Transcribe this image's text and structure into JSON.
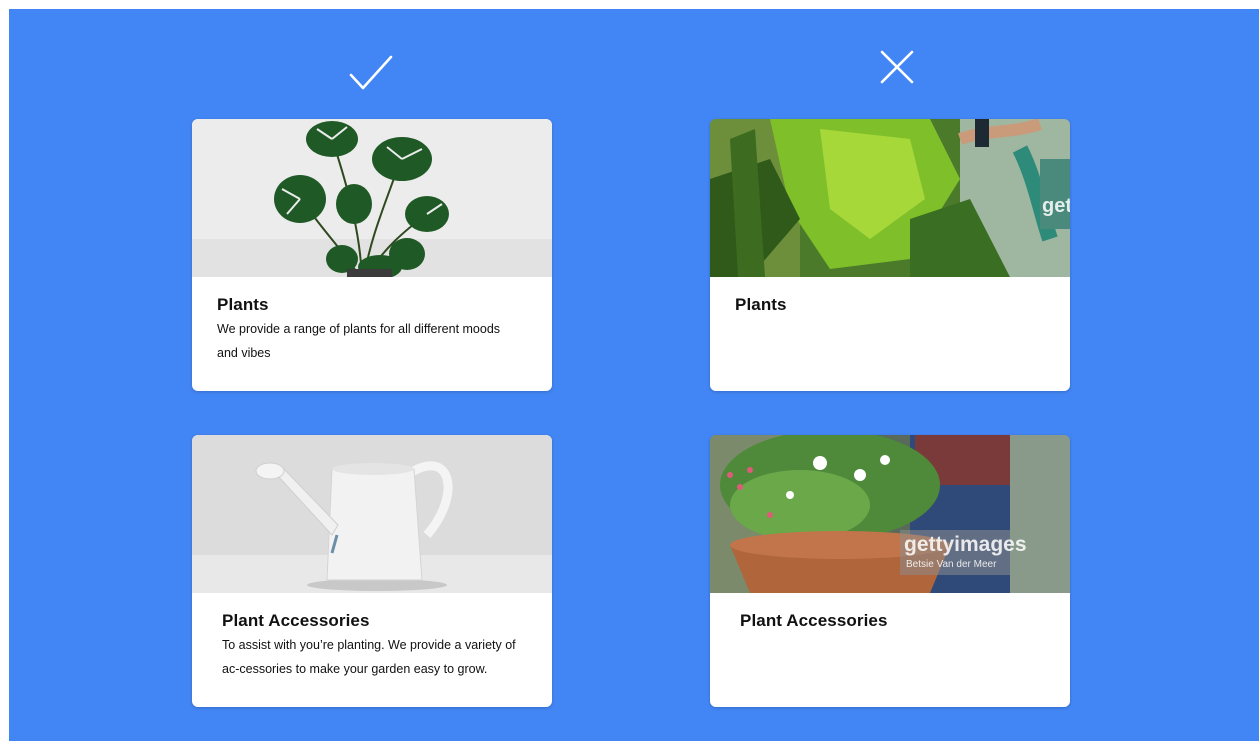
{
  "indicators": {
    "good": "check-icon",
    "bad": "close-icon"
  },
  "colors": {
    "background": "#4285f4",
    "card": "#ffffff",
    "text": "#111111"
  },
  "good_examples": [
    {
      "title": "Plants",
      "description": "We provide a range of plants for all different moods and vibes",
      "image": "monstera-plant-photo"
    },
    {
      "title": "Plant Accessories",
      "description": "To assist with you’re planting. We provide a variety of ac-cessories to make your garden easy to grow.",
      "image": "watering-can-photo"
    }
  ],
  "bad_examples": [
    {
      "title": "Plants",
      "image": "stock-photo-leaves",
      "watermark": "gett"
    },
    {
      "title": "Plant Accessories",
      "image": "stock-photo-flower-pot",
      "watermark": "gettyimages",
      "watermark_credit": "Betsie Van der Meer"
    }
  ]
}
